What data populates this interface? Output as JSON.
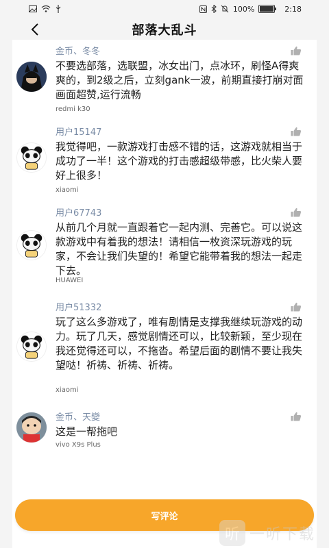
{
  "status_bar": {
    "battery": "100%",
    "time": "2:18",
    "battery_level": 1.0,
    "icons": [
      "nfc-icon",
      "bluetooth-icon",
      "mute-icon",
      "wifi-icon",
      "signal-icon",
      "usb-icon",
      "image-icon"
    ]
  },
  "header": {
    "title": "部落大乱斗",
    "back_icon": "chevron-left-icon"
  },
  "comments": [
    {
      "user": "金币、冬冬",
      "text": "不要选部落，选联盟，冰女出门，点冰环，刷怪A得爽爽的，到2级之后，立刻gank一波，前期直接打崩对面画面超赞,运行流畅",
      "device": "redmi k30",
      "avatar": "dark-hero-avatar"
    },
    {
      "user": "用户15147",
      "text": "我觉得吧，一款游戏打击感不错的话，这游戏就相当于成功了一半！这个游戏的打击感超级带感，比火柴人要好上很多！",
      "device": "xiaomi",
      "avatar": "panda-avatar"
    },
    {
      "user": "用户67743",
      "text": "从前几个月就一直跟着它一起内测、完善它。可以说这款游戏中有着我的想法！请相信一枚资深玩游戏的玩家，不会让我们失望的！希望它能带着我的想法一起走下去。",
      "device": "HUAWEI",
      "avatar": "panda-avatar"
    },
    {
      "user": "用户51332",
      "text": "玩了这么多游戏了，唯有剧情是支撑我继续玩游戏的动力。玩了几天，感觉剧情还可以，比较新颖，至少现在我还觉得还可以，不拖沓。希望后面的剧情不要让我失望哒！祈祷、祈祷、祈祷。",
      "device": "xiaomi",
      "avatar": "panda-avatar"
    },
    {
      "user": "金币、天變",
      "text": "这是一帮拖吧",
      "device": "vivo X9s Plus",
      "avatar": "cartoon-boy-avatar"
    }
  ],
  "write_button": {
    "label": "写评论"
  },
  "watermark": {
    "text": "一听下载",
    "logo_glyph": "听"
  },
  "colors": {
    "accent": "#f7a62a",
    "username": "#7a8ca6",
    "background": "#f4f4f4",
    "card": "#ffffff"
  }
}
